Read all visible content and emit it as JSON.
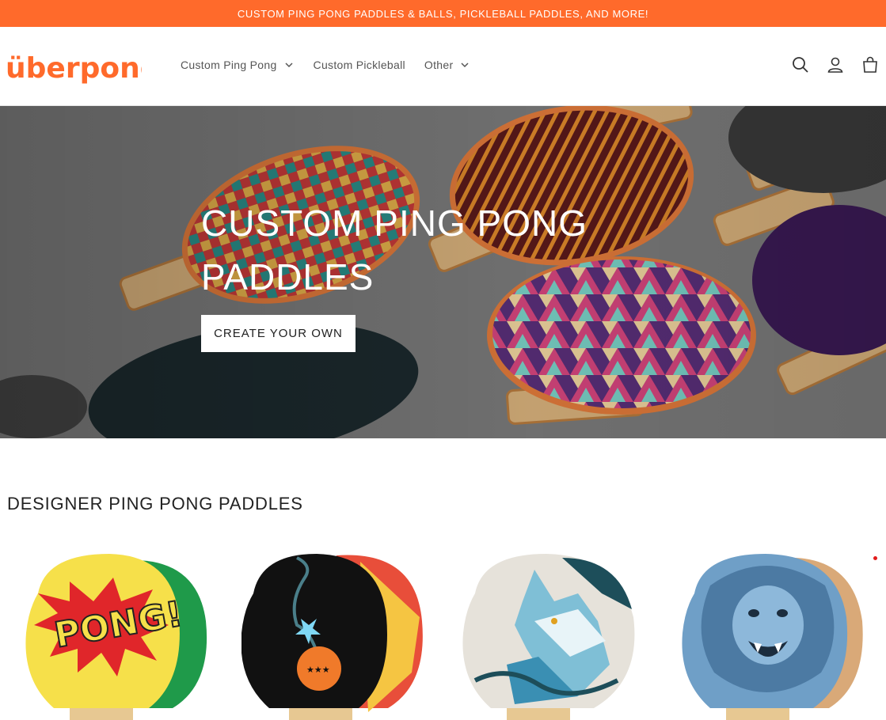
{
  "announcement": "CUSTOM PING PONG PADDLES & BALLS, PICKLEBALL PADDLES, AND MORE!",
  "brand": {
    "logo_text": "überpong",
    "color": "#ff6a2b"
  },
  "nav": {
    "items": [
      {
        "label": "Custom Ping Pong",
        "has_dropdown": true
      },
      {
        "label": "Custom Pickleball",
        "has_dropdown": false
      },
      {
        "label": "Other",
        "has_dropdown": true
      }
    ]
  },
  "header_icons": [
    "search-icon",
    "account-icon",
    "cart-icon"
  ],
  "hero": {
    "title": "CUSTOM PING PONG PADDLES",
    "button_label": "CREATE YOUR OWN"
  },
  "section": {
    "title": "DESIGNER PING PONG PADDLES"
  },
  "products": [
    {
      "design": "pong-comic-burst"
    },
    {
      "design": "cartoon-bomb"
    },
    {
      "design": "wolf-illustration"
    },
    {
      "design": "roaring-lion-illustration"
    }
  ]
}
